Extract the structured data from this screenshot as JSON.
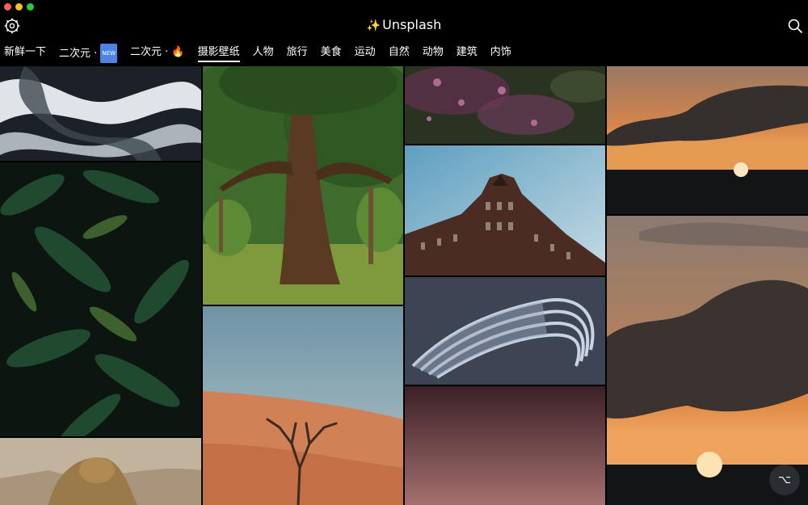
{
  "app": {
    "title": "Unsplash"
  },
  "tabs": [
    {
      "label": "新鲜一下",
      "active": false
    },
    {
      "label": "二次元 · ",
      "badge": "NEW",
      "active": false
    },
    {
      "label": "二次元 · ",
      "active": false
    },
    {
      "label": "摄影壁纸",
      "active": true
    },
    {
      "label": "人物",
      "active": false
    },
    {
      "label": "旅行",
      "active": false
    },
    {
      "label": "美食",
      "active": false
    },
    {
      "label": "运动",
      "active": false
    },
    {
      "label": "自然",
      "active": false
    },
    {
      "label": "动物",
      "active": false
    },
    {
      "label": "建筑",
      "active": false
    },
    {
      "label": "内饰",
      "active": false
    }
  ],
  "fab": {
    "symbol": "⌥"
  },
  "icons": {
    "settings": "gear-icon",
    "search": "search-icon",
    "fire": "fire-icon"
  },
  "colors": {
    "tab_underline": "#ffffff",
    "badge": "#4c84e8"
  }
}
